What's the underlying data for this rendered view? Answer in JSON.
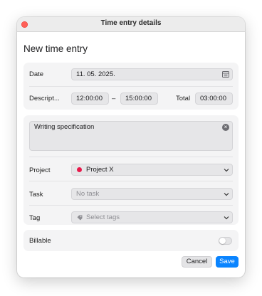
{
  "window": {
    "title": "Time entry details"
  },
  "heading": "New time entry",
  "date": {
    "label": "Date",
    "value": "11. 05. 2025."
  },
  "description_row": {
    "label": "Descript...",
    "start": "12:00:00",
    "separator": "–",
    "end": "15:00:00",
    "total_label": "Total",
    "total": "03:00:00"
  },
  "description": {
    "value": "Writing specification"
  },
  "project": {
    "label": "Project",
    "value": "Project X",
    "dot_color": "#e8194b"
  },
  "task": {
    "label": "Task",
    "placeholder": "No task"
  },
  "tag": {
    "label": "Tag",
    "placeholder": "Select tags"
  },
  "billable": {
    "label": "Billable",
    "enabled": false
  },
  "buttons": {
    "cancel": "Cancel",
    "save": "Save"
  },
  "colors": {
    "accent": "#0a84ff",
    "close": "#ff5f57"
  }
}
